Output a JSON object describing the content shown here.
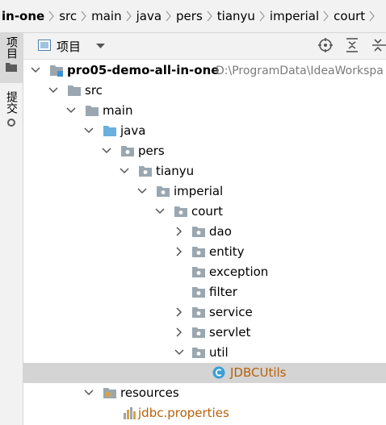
{
  "breadcrumb": [
    "in-one",
    "src",
    "main",
    "java",
    "pers",
    "tianyu",
    "imperial",
    "court"
  ],
  "left_strip": {
    "project_tab": "项目",
    "commit_tab": "提交"
  },
  "panel": {
    "title": "项目"
  },
  "tree": {
    "root": {
      "label": "pro05-demo-all-in-one",
      "path": "D:\\ProgramData\\IdeaWorkspa"
    },
    "src": "src",
    "main": "main",
    "java": "java",
    "pers": "pers",
    "tianyu": "tianyu",
    "imperial": "imperial",
    "court": "court",
    "court_children": [
      "dao",
      "entity",
      "exception",
      "filter",
      "service",
      "servlet",
      "util"
    ],
    "util_file": "JDBCUtils",
    "resources": "resources",
    "resources_file": "jdbc.properties"
  },
  "colors": {
    "folder": "#9aa7b0",
    "source_folder": "#6ab0de",
    "class_icon": "#389fd6",
    "resource_text": "#b8610a",
    "selection": "#d4d4d4"
  }
}
